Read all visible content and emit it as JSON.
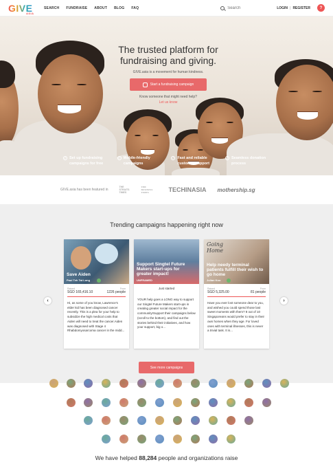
{
  "nav": {
    "logo_text": "GIVE",
    "logo_sub": "ASIA",
    "menu": [
      "SEARCH",
      "FUNDRAISE",
      "ABOUT",
      "BLOG",
      "FAQ"
    ],
    "search_placeholder": "Search",
    "login": "LOGIN",
    "register": "REGISTER",
    "sep": "|",
    "question_icon": "?"
  },
  "hero": {
    "title_line1": "The trusted platform for",
    "title_line2": "fundraising and giving.",
    "subtitle": "GIVE.asia is a movement for human kindness.",
    "start_button": "Start a fundraising campaign",
    "question": "Know someone that might need help?",
    "question_link": "Let us know",
    "features": [
      {
        "line1": "Set up fundraising",
        "line2": "campaigns for free"
      },
      {
        "line1": "Mobile-friendly",
        "line2": "campaigns"
      },
      {
        "line1": "Fast and reliable",
        "line2": "customer support"
      },
      {
        "line1": "Seamless donation",
        "line2": "process"
      }
    ]
  },
  "featured": {
    "label": "GIVE.asia has been featured in",
    "publications": [
      "THE STRAITS TIMES",
      "THE BUSINESS TIMES",
      "TECHINASIA",
      "mothership.sg"
    ]
  },
  "trending": {
    "heading": "Trending campaigns happening right now",
    "prev_icon": "‹",
    "next_icon": "›",
    "more_button": "See more campaigns",
    "cards": [
      {
        "title": "Save Aiden",
        "owner": "Paul Teh Tat Long",
        "raised_label": "Raised",
        "raised": "SGD 165,416.10",
        "from_label": "From",
        "from": "1226 people",
        "desc": "Hi, as some of you know, Lawrence's elder kid has been diagnosed cancer recently. This is a plea for your help to subsidize the high medical costs that Aiden will need to treat the cancer.Aiden was diagnosed with Stage 4 Rhabdomyosarcoma cancer in the midd..."
      },
      {
        "title": "Support Singtel Future Makers start-ups for greater impact!",
        "owner": "UNFRAMED",
        "status": "Just started",
        "desc": "YOUR help goes a LONG way to support our Singtel Future Makers start-ups in creating greater social impact for the community!Support their campaigns below (scroll to the bottom), and find out the stories behind their initiatives, and how your support, big o..."
      },
      {
        "title": "Help needy terminal patients fulfill their wish to go home",
        "owner": "Julian Koo",
        "overlay_word": "Going Home",
        "raised_label": "Raised",
        "raised": "SGD 5,325.00",
        "from_label": "From",
        "from": "81 people",
        "desc": "Have you ever lost someone dear to you, and wished you could spend those last sweet moments with them? 8 out of 10 Singaporeans would prefer to stay in their own homes when they age. For loved ones with terminal illnesses, this is never a trivial task. It is..."
      }
    ]
  },
  "helped": {
    "prefix": "We have helped",
    "count": "88,284",
    "suffix": "people and organizations raise"
  },
  "colors": {
    "accent": "#e8696a",
    "trend_bg": "#efefef"
  }
}
